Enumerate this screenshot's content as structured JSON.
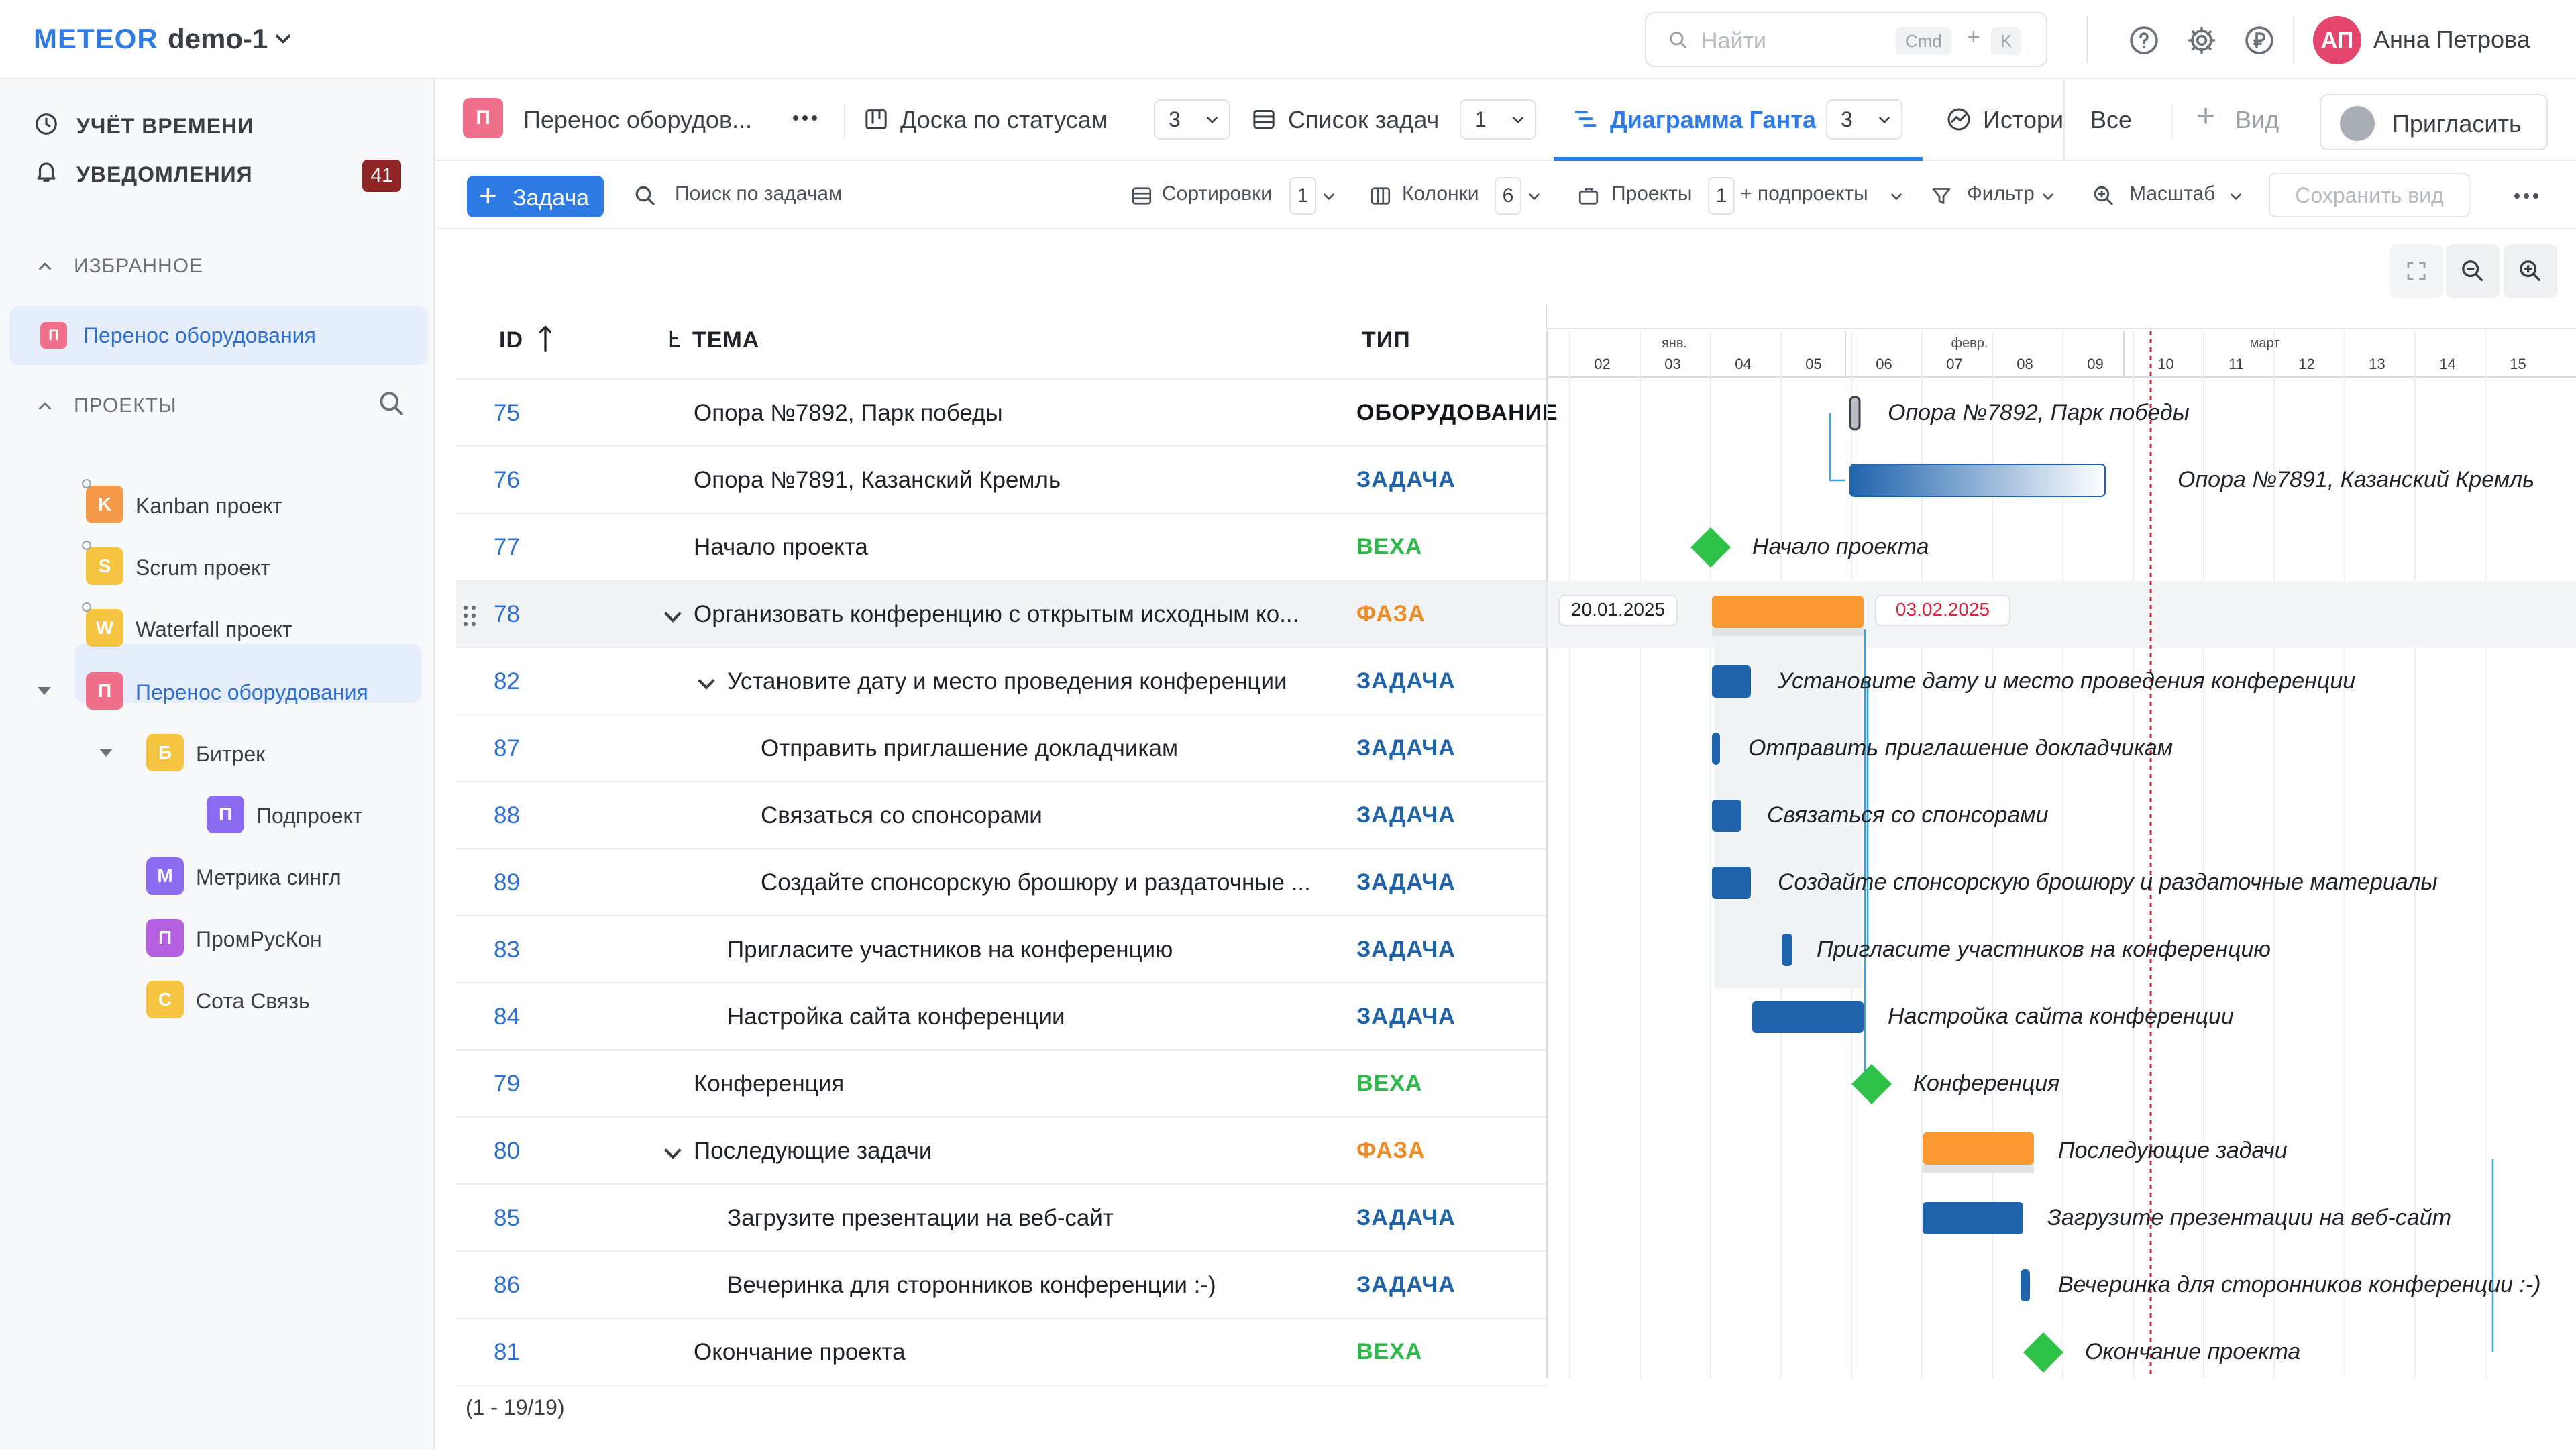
{
  "topbar": {
    "logo": "METEOR",
    "workspace": "demo-1",
    "search_placeholder": "Найти",
    "kbd1": "Cmd",
    "kbd_plus": "+",
    "kbd2": "K",
    "user_initials": "АП",
    "user_name": "Анна Петрова"
  },
  "sidebar": {
    "time_tracking": "УЧЁТ ВРЕМЕНИ",
    "notifications": "УВЕДОМЛЕНИЯ",
    "notifications_count": "41",
    "favorites_label": "ИЗБРАННОЕ",
    "favorite_item": {
      "letter": "П",
      "name": "Перенос оборудования",
      "color": "#f0708c"
    },
    "projects_label": "ПРОЕКТЫ",
    "projects": [
      {
        "letter": "K",
        "name": "Kanban проект",
        "color": "#f59a4a"
      },
      {
        "letter": "S",
        "name": "Scrum проект",
        "color": "#f5c542"
      },
      {
        "letter": "W",
        "name": "Waterfall проект",
        "color": "#f5c542"
      },
      {
        "letter": "П",
        "name": "Перенос оборудования",
        "color": "#f0708c"
      },
      {
        "letter": "Б",
        "name": "Битрек",
        "color": "#f5c542"
      },
      {
        "letter": "П",
        "name": "Подпроект",
        "color": "#8b6cf0"
      },
      {
        "letter": "М",
        "name": "Метрика сингл",
        "color": "#8b6cf0"
      },
      {
        "letter": "П",
        "name": "ПромРусКон",
        "color": "#b45ee0"
      },
      {
        "letter": "С",
        "name": "Сота Связь",
        "color": "#f5c542"
      }
    ]
  },
  "tabs": {
    "project": {
      "letter": "П",
      "title": "Перенос оборудов...",
      "color": "#f0708c"
    },
    "items": [
      {
        "label": "Доска по статусам",
        "count": "3"
      },
      {
        "label": "Список задач",
        "count": "1"
      },
      {
        "label": "Диаграмма Ганта",
        "count": "3"
      },
      {
        "label": "Истори"
      },
      {
        "label": "Все"
      }
    ],
    "add_view": "Вид",
    "invite": "Пригласить"
  },
  "toolbar": {
    "add_task": "Задача",
    "search": "Поиск по задачам",
    "sorts": "Сортировки",
    "sorts_count": "1",
    "columns": "Колонки",
    "columns_count": "6",
    "projects": "Проекты",
    "projects_count": "1",
    "subprojects": "+ подпроекты",
    "filter": "Фильтр",
    "scale": "Масштаб",
    "save_view": "Сохранить вид"
  },
  "table": {
    "headers": {
      "id": "ID",
      "subject": "ТЕМА",
      "type": "ТИП"
    },
    "rows": [
      {
        "id": "75",
        "subject": "Опора №7892, Парк победы",
        "type": "ОБОРУДОВАНИЕ",
        "indent": 0
      },
      {
        "id": "76",
        "subject": "Опора №7891, Казанский Кремль",
        "type": "ЗАДАЧА",
        "indent": 0
      },
      {
        "id": "77",
        "subject": "Начало проекта",
        "type": "ВЕХА",
        "indent": 0
      },
      {
        "id": "78",
        "subject": "Организовать конференцию с открытым исходным ко...",
        "type": "ФАЗА",
        "indent": 0,
        "expand": true
      },
      {
        "id": "82",
        "subject": "Установите дату и место проведения конференции",
        "type": "ЗАДАЧА",
        "indent": 1,
        "expand": true
      },
      {
        "id": "87",
        "subject": "Отправить приглашение докладчикам",
        "type": "ЗАДАЧА",
        "indent": 2
      },
      {
        "id": "88",
        "subject": "Связаться со спонсорами",
        "type": "ЗАДАЧА",
        "indent": 2
      },
      {
        "id": "89",
        "subject": "Создайте спонсорскую брошюру и раздаточные ...",
        "type": "ЗАДАЧА",
        "indent": 2
      },
      {
        "id": "83",
        "subject": "Пригласите участников на конференцию",
        "type": "ЗАДАЧА",
        "indent": 1
      },
      {
        "id": "84",
        "subject": "Настройка сайта конференции",
        "type": "ЗАДАЧА",
        "indent": 1
      },
      {
        "id": "79",
        "subject": "Конференция",
        "type": "ВЕХА",
        "indent": 0
      },
      {
        "id": "80",
        "subject": "Последующие задачи",
        "type": "ФАЗА",
        "indent": 0,
        "expand": true
      },
      {
        "id": "85",
        "subject": "Загрузите презентации на веб-сайт",
        "type": "ЗАДАЧА",
        "indent": 1
      },
      {
        "id": "86",
        "subject": "Вечеринка для сторонников конференции :-)",
        "type": "ЗАДАЧА",
        "indent": 1
      },
      {
        "id": "81",
        "subject": "Окончание проекта",
        "type": "ВЕХА",
        "indent": 0
      }
    ],
    "pager": "(1 - 19/19)"
  },
  "type_colors": {
    "ОБОРУДОВАНИЕ": "#111418",
    "ЗАДАЧА": "#1f63ad",
    "ВЕХА": "#2fb84a",
    "ФАЗА": "#f08a24"
  },
  "gantt": {
    "months": [
      "янв.",
      "февр.",
      "март"
    ],
    "weeks": [
      "02",
      "03",
      "04",
      "05",
      "06",
      "07",
      "08",
      "09",
      "10",
      "11",
      "12",
      "13",
      "14",
      "15"
    ],
    "phase_start_label": "20.01.2025",
    "phase_end_label": "03.02.2025",
    "bar_labels": [
      "Опора №7892, Парк победы",
      "Опора №7891, Казанский Кремль",
      "Начало проекта",
      "",
      "Установите дату и место проведения конференции",
      "Отправить приглашение докладчикам",
      "Связаться со спонсорами",
      "Создайте спонсорскую брошюру и раздаточные материалы",
      "Пригласите участников на конференцию",
      "Настройка сайта конференции",
      "Конференция",
      "Последующие задачи",
      "Загрузите презентации на веб-сайт",
      "Вечеринка для сторонников конференции :-)",
      "Окончание проекта"
    ],
    "colors": {
      "task": "#1f63ad",
      "phase": "#fb9a33",
      "milestone": "#2fc24a",
      "today": "#d9263a"
    }
  }
}
